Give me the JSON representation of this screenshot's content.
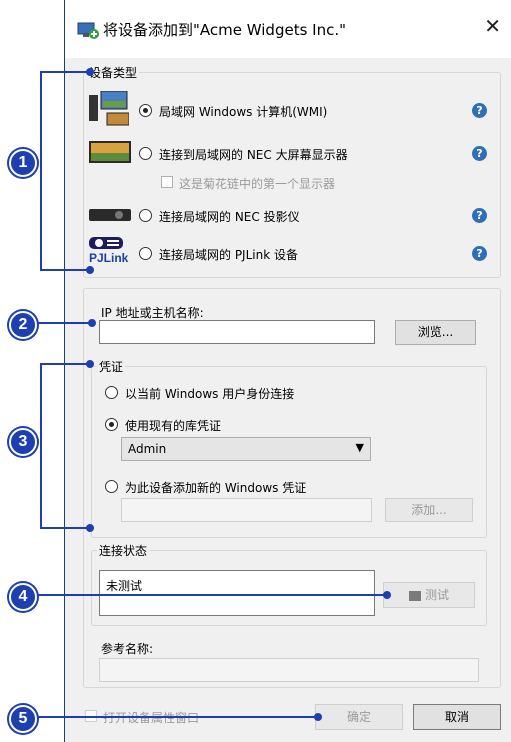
{
  "window": {
    "title": "将设备添加到\"Acme Widgets Inc.\"",
    "close": "✕"
  },
  "device_type": {
    "label": "设备类型",
    "options": [
      {
        "label": "局域网 Windows 计算机(WMI)",
        "selected": true
      },
      {
        "label": "连接到局域网的 NEC 大屏幕显示器",
        "selected": false
      },
      {
        "label": "连接局域网的 NEC 投影仪",
        "selected": false
      },
      {
        "label": "连接局域网的 PJLink 设备",
        "selected": false
      }
    ],
    "daisy_chain": "这是菊花链中的第一个显示器",
    "pjlink_logo": "PJLink"
  },
  "address": {
    "label": "IP 地址或主机名称:",
    "value": "",
    "browse": "浏览..."
  },
  "credentials": {
    "label": "凭证",
    "opt_current": "以当前 Windows 用户身份连接",
    "opt_existing": "使用现有的库凭证",
    "selected_cred": "Admin",
    "opt_new": "为此设备添加新的 Windows 凭证",
    "add": "添加..."
  },
  "connection": {
    "label": "连接状态",
    "status": "未测试",
    "test": "测试"
  },
  "reference": {
    "label": "参考名称:",
    "value": ""
  },
  "footer": {
    "open_props": "打开设备属性窗口",
    "ok": "确定",
    "cancel": "取消"
  },
  "callouts": [
    "1",
    "2",
    "3",
    "4",
    "5"
  ],
  "colors": {
    "callout": "#1d3fb0",
    "help": "#2f6fb8"
  }
}
